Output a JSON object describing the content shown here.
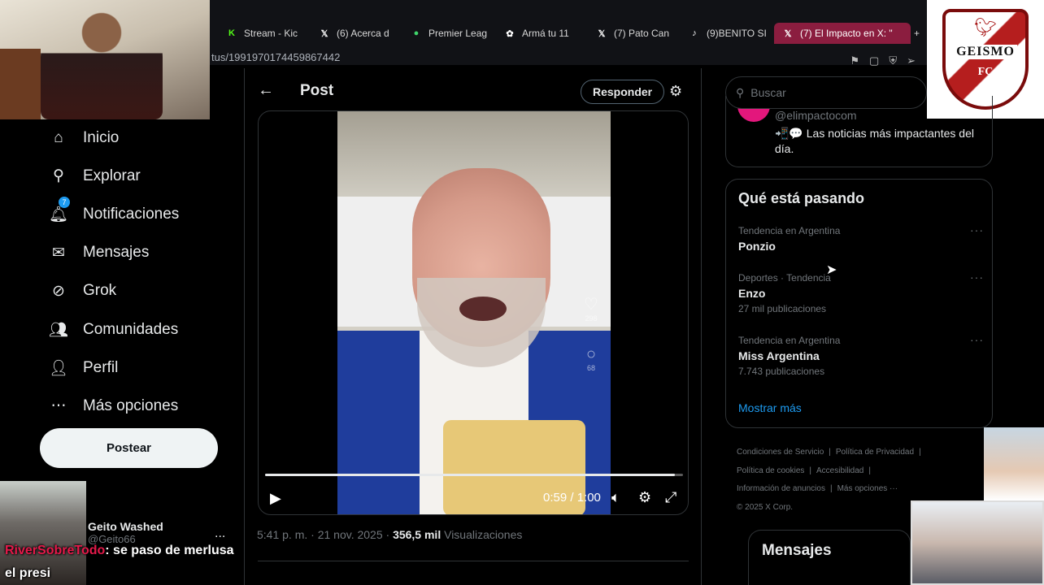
{
  "browser": {
    "tabs": [
      {
        "label": "Stream - Kic",
        "icon": "kick-icon",
        "glyph": "K",
        "color": "#53fc18"
      },
      {
        "label": "(6) Acerca d",
        "icon": "x-icon",
        "glyph": "𝕏",
        "color": "#ffffff"
      },
      {
        "label": "Premier Leag",
        "icon": "premier-league-icon",
        "glyph": "●",
        "color": "#3fd46b"
      },
      {
        "label": "Armá tu 11",
        "icon": "gear-tab-icon",
        "glyph": "✿",
        "color": "#ffffff"
      },
      {
        "label": "(7) Pato Can",
        "icon": "x-icon",
        "glyph": "𝕏",
        "color": "#ffffff"
      },
      {
        "label": "(9)BENITO SI",
        "icon": "tiktok-icon",
        "glyph": "♪",
        "color": "#ffffff"
      },
      {
        "label": "(7) El Impacto en X: \"",
        "icon": "x-icon",
        "glyph": "𝕏",
        "color": "#ffffff",
        "active": true
      }
    ],
    "new_tab": "+",
    "url": "tus/1991970174459867442"
  },
  "overlays": {
    "logo_name": "GEISMO",
    "logo_fc": "FC",
    "chat_user": "RiverSobreTodo",
    "chat_message": ": se paso de merlusa",
    "chat_line2": "el presi"
  },
  "sidebar": {
    "items": [
      {
        "label": "Inicio",
        "icon": "home-icon",
        "glyph": "⌂"
      },
      {
        "label": "Explorar",
        "icon": "search-icon",
        "glyph": "⚲"
      },
      {
        "label": "Notificaciones",
        "icon": "bell-icon",
        "glyph": "🔔︎",
        "badge": "7"
      },
      {
        "label": "Mensajes",
        "icon": "mail-icon",
        "glyph": "✉"
      },
      {
        "label": "Grok",
        "icon": "grok-icon",
        "glyph": "⊘"
      },
      {
        "label": "Comunidades",
        "icon": "communities-icon",
        "glyph": "👥︎"
      },
      {
        "label": "Perfil",
        "icon": "profile-icon",
        "glyph": "👤︎"
      },
      {
        "label": "Más opciones",
        "icon": "more-options-icon",
        "glyph": "⋯"
      }
    ],
    "post_button": "Postear",
    "user_name": "Geito Washed",
    "user_handle": "@Geito66",
    "user_more": "..."
  },
  "main": {
    "title": "Post",
    "reply_button": "Responder",
    "video": {
      "time": "0:59 / 1:00",
      "progress": 0.98,
      "side_likes": "298",
      "side_comments": "68"
    },
    "timestamp": "5:41 p. m. · 21 nov. 2025 · ",
    "views": "356,5 mil",
    "views_label": " Visualizaciones"
  },
  "right": {
    "search_placeholder": "Buscar",
    "profile_handle": "@elimpactocom",
    "profile_bio": "📲💬 Las noticias más impactantes del día.",
    "trends_title": "Qué está pasando",
    "trends": [
      {
        "context": "Tendencia en Argentina",
        "name": "Ponzio",
        "count": ""
      },
      {
        "context": "Deportes · Tendencia",
        "name": "Enzo",
        "count": "27 mil publicaciones"
      },
      {
        "context": "Tendencia en Argentina",
        "name": "Miss Argentina",
        "count": "7.743 publicaciones"
      }
    ],
    "show_more": "Mostrar más",
    "footer": [
      [
        "Condiciones de Servicio",
        "Política de Privacidad"
      ],
      [
        "Política de cookies",
        "Accesibilidad"
      ],
      [
        "Información de anuncios",
        "Más opciones ···"
      ],
      [
        "© 2025 X Corp."
      ]
    ],
    "messages_title": "Mensajes"
  },
  "colors": {
    "accent": "#1d9bf0",
    "active_tab": "#8b1d3f",
    "background": "#000000"
  }
}
